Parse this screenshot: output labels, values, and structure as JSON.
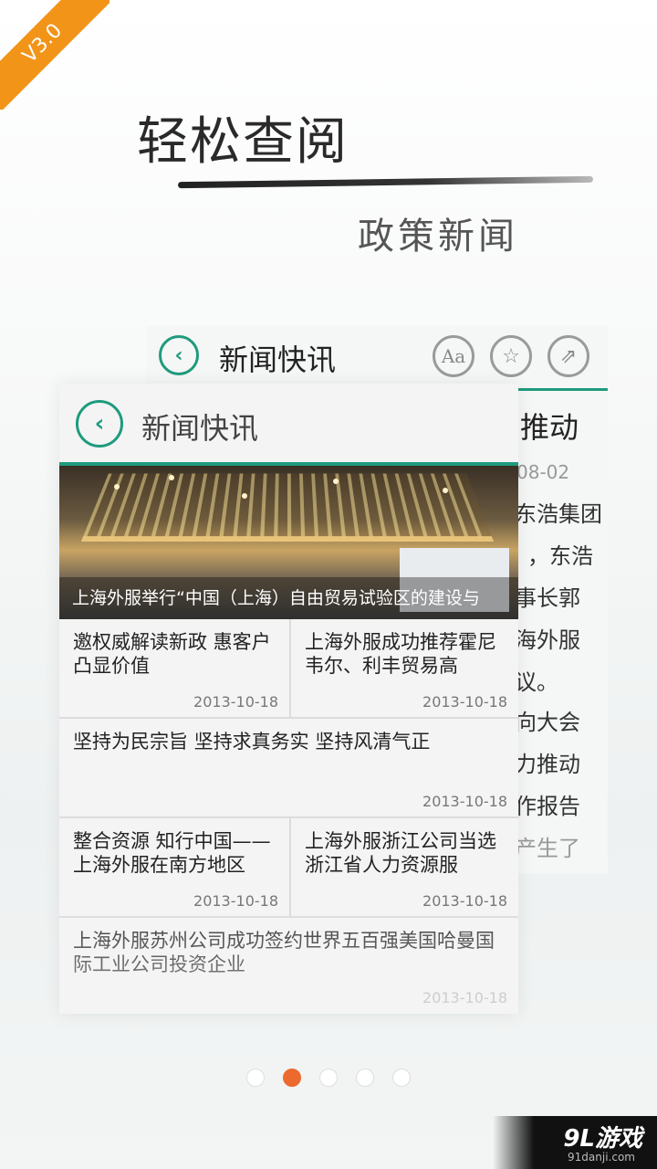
{
  "version_badge": "V3.0",
  "hero": {
    "title": "轻松查阅",
    "subtitle": "政策新闻"
  },
  "back_card": {
    "title": "新闻快讯",
    "heading": "推动",
    "date": "08-02",
    "lines": [
      "东浩集团",
      "，东浩",
      "事长郭",
      "海外服",
      "议。",
      "向大会",
      "力推动",
      "作报告",
      "产生了"
    ]
  },
  "front_card": {
    "title": "新闻快讯",
    "banner_caption": "上海外服举行“中国（上海）自由贸易试验区的建设与",
    "items": [
      {
        "title": "邀权威解读新政 惠客户凸显价值",
        "date": "2013-10-18"
      },
      {
        "title": "上海外服成功推荐霍尼韦尔、利丰贸易高",
        "date": "2013-10-18"
      },
      {
        "title": "坚持为民宗旨 坚持求真务实 坚持风清气正",
        "date": "2013-10-18"
      },
      {
        "title": "整合资源 知行中国——上海外服在南方地区",
        "date": "2013-10-18"
      },
      {
        "title": "上海外服浙江公司当选浙江省人力资源服",
        "date": "2013-10-18"
      },
      {
        "title": "上海外服苏州公司成功签约世界五百强美国哈曼国际工业公司投资企业",
        "date": "2013-10-18"
      }
    ]
  },
  "pager": {
    "count": 5,
    "active_index": 1
  },
  "watermark": {
    "logo": "9L游戏",
    "url": "91danji.com"
  },
  "colors": {
    "accent": "#1e9b7d",
    "badge": "#f29418",
    "active_dot": "#ec6a2e"
  }
}
